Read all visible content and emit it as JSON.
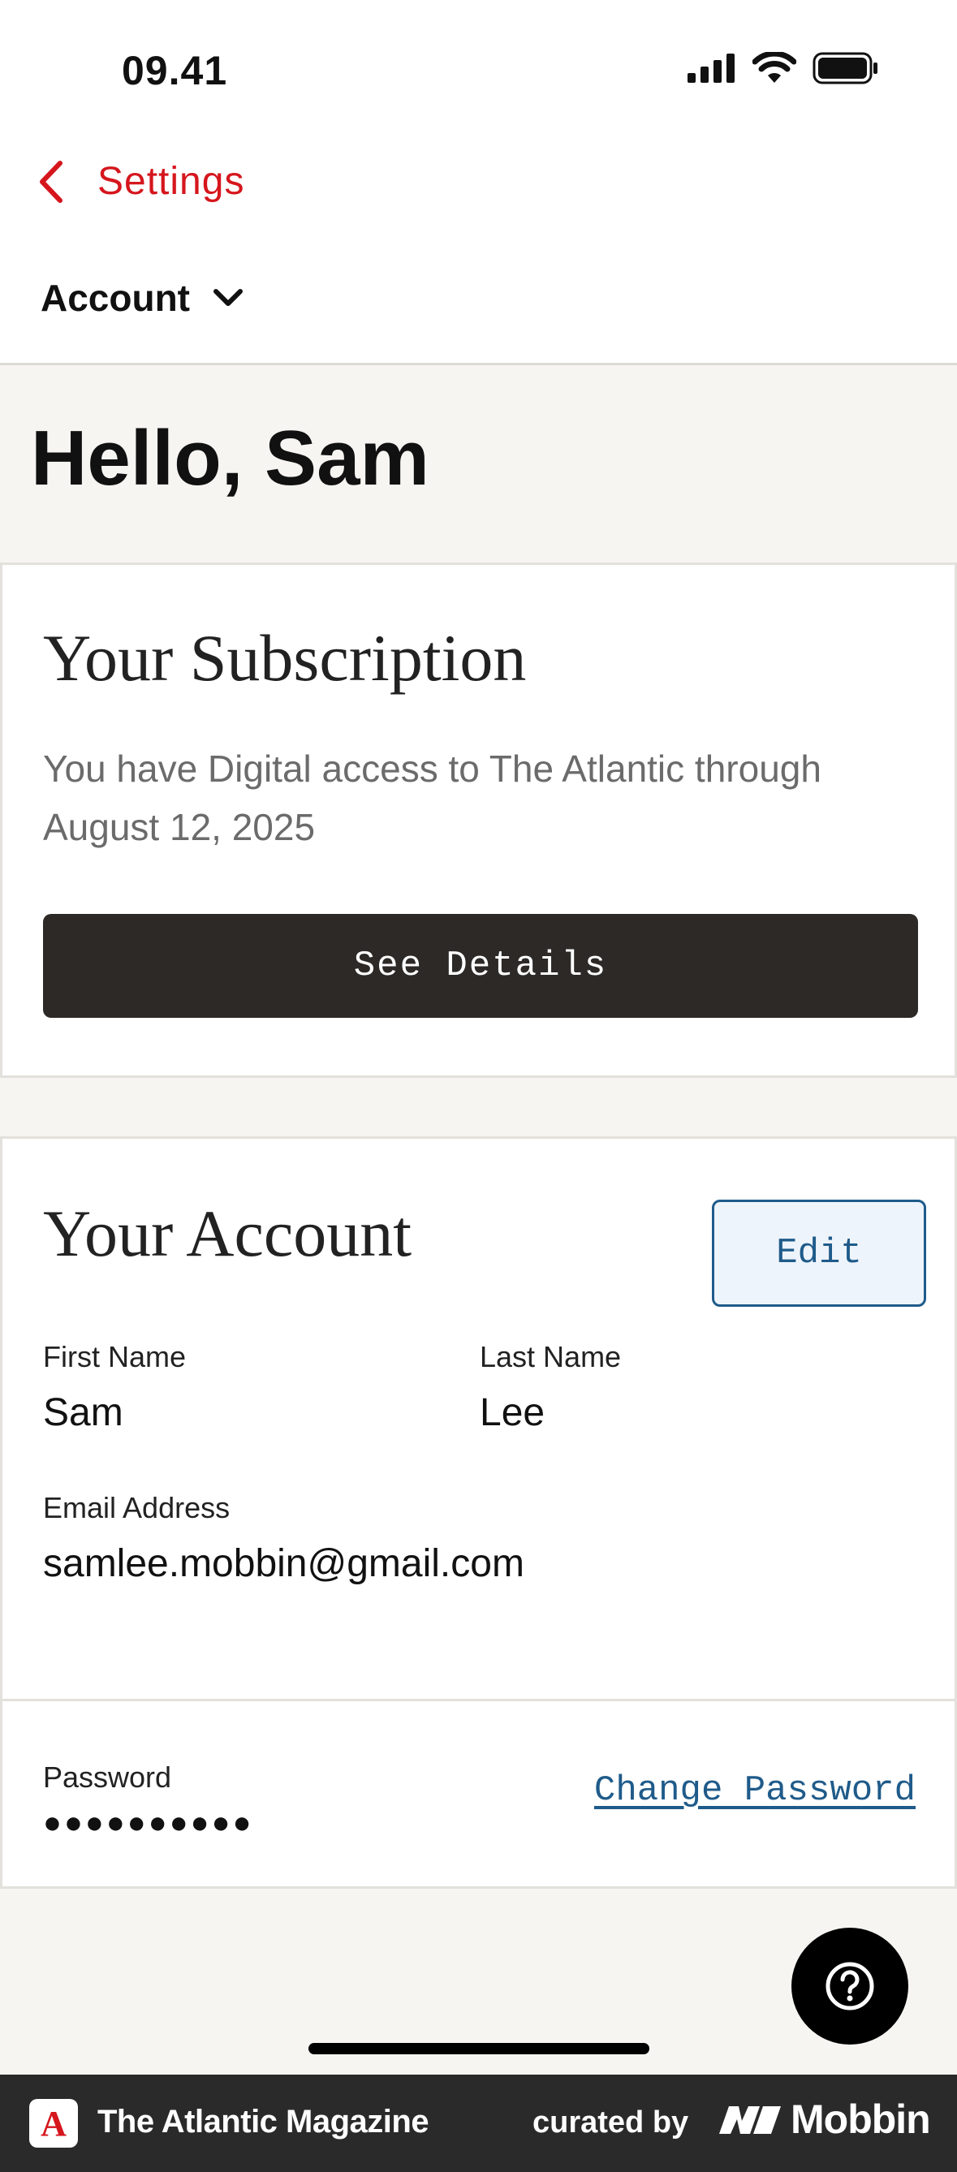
{
  "status_bar": {
    "time": "09.41"
  },
  "nav": {
    "back_label": "Settings",
    "section_label": "Account"
  },
  "greeting": "Hello, Sam",
  "subscription": {
    "title": "Your Subscription",
    "description": "You have Digital access to The Atlantic through August 12, 2025",
    "button_label": "See Details"
  },
  "account": {
    "title": "Your Account",
    "edit_label": "Edit",
    "first_name_label": "First Name",
    "first_name": "Sam",
    "last_name_label": "Last Name",
    "last_name": "Lee",
    "email_label": "Email Address",
    "email": "samlee.mobbin@gmail.com",
    "password_label": "Password",
    "password_mask": "●●●●●●●●●●",
    "change_password_label": "Change Password"
  },
  "footer": {
    "logo_letter": "A",
    "app_name": "The Atlantic Magazine",
    "curated_by": "curated by",
    "brand": "Mobbin"
  },
  "colors": {
    "accent_red": "#d5161d",
    "link_blue": "#1f5b8a",
    "dark_button": "#2c2927"
  },
  "icons": [
    "signal-icon",
    "wifi-icon",
    "battery-icon",
    "chevron-left-icon",
    "chevron-down-icon",
    "help-icon",
    "mobbin-logo-icon"
  ]
}
